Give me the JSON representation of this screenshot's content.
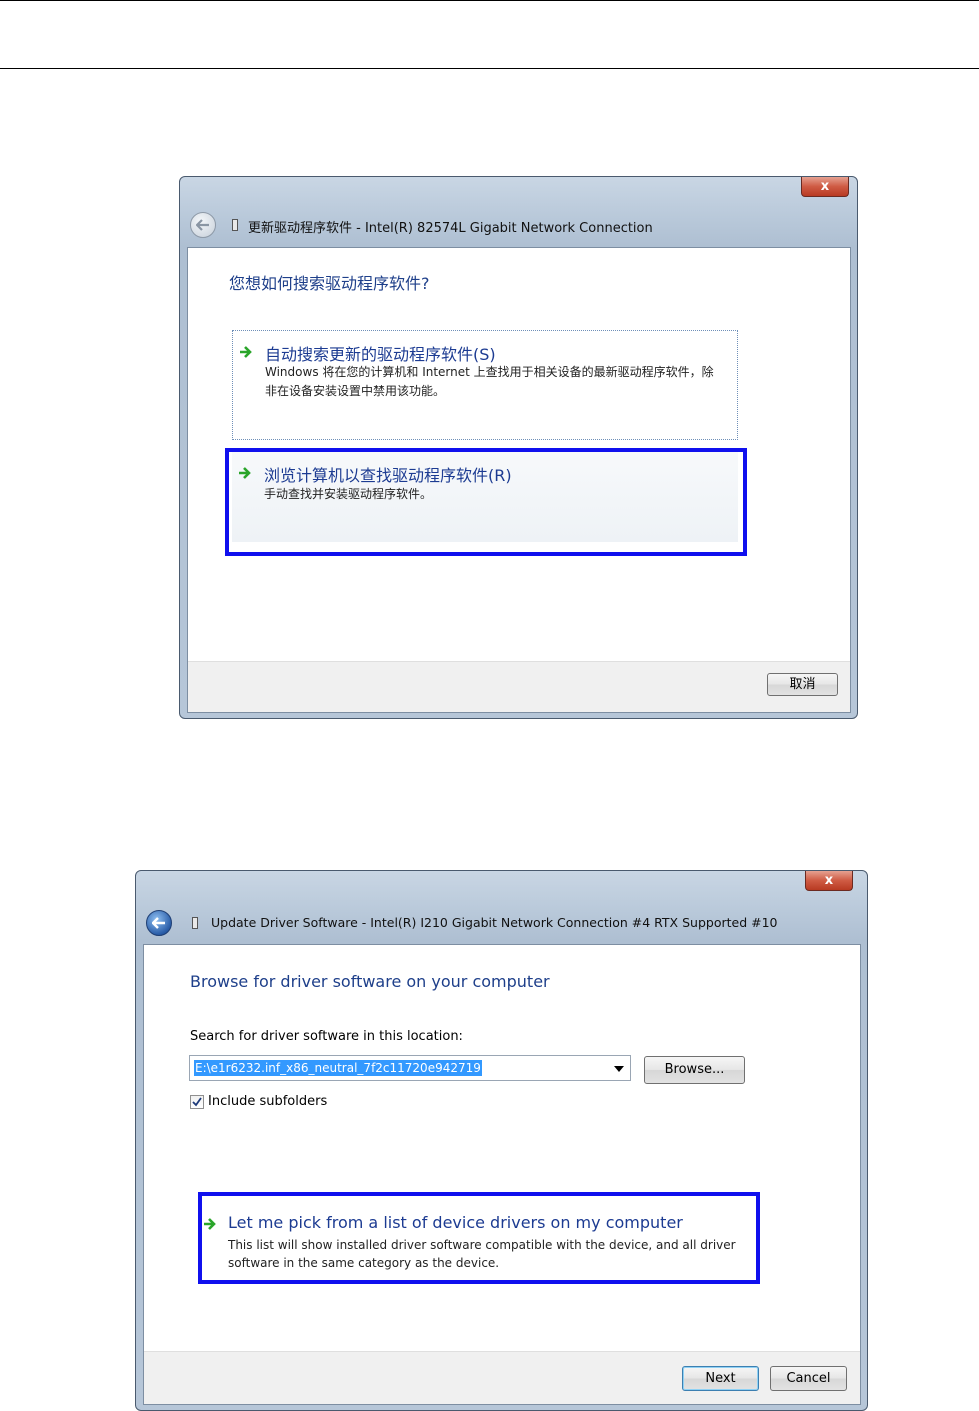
{
  "dialog_cn": {
    "title": "更新驱动程序软件 - Intel(R) 82574L Gigabit Network Connection",
    "heading": "您想如何搜索驱动程序软件?",
    "options": [
      {
        "title": "自动搜索更新的驱动程序软件(S)",
        "description": "Windows 将在您的计算机和 Internet 上查找用于相关设备的最新驱动程序软件，除非在设备安装设置中禁用该功能。"
      },
      {
        "title": "浏览计算机以查找驱动程序软件(R)",
        "description": "手动查找并安装驱动程序软件。"
      }
    ],
    "cancel_label": "取消",
    "close_label": "x",
    "icons": [
      "back-arrow-icon",
      "device-icon",
      "green-arrow-icon"
    ]
  },
  "dialog_en": {
    "title": "Update Driver Software - Intel(R) I210 Gigabit Network Connection #4 RTX Supported #10",
    "heading": "Browse for driver software on your computer",
    "search_label": "Search for driver software in this location:",
    "path_value": "E:\\e1r6232.inf_x86_neutral_7f2c11720e942719",
    "browse_label": "Browse...",
    "include_subfolders_label": "Include subfolders",
    "include_subfolders_checked": true,
    "pick_title": "Let me pick from a list of device drivers on my computer",
    "pick_description": "This list will show installed driver software compatible with the device, and all driver software in the same category as the device.",
    "next_label": "Next",
    "cancel_label": "Cancel",
    "close_label": "x",
    "icons": [
      "back-arrow-icon",
      "device-icon",
      "green-arrow-icon",
      "dropdown-arrow-icon",
      "checkmark-icon"
    ]
  },
  "colors": {
    "highlight": "#1010ee",
    "link_blue": "#1c3b92",
    "arrow_green": "#2aa52a"
  }
}
